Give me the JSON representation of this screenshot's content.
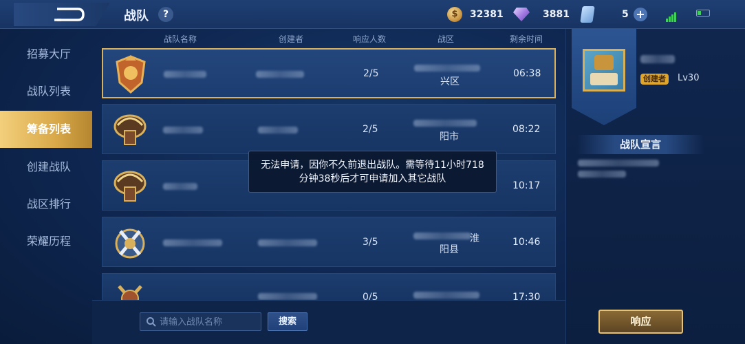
{
  "header": {
    "title": "战队",
    "help_label": "?",
    "currencies": {
      "coins": "32381",
      "gems": "3881",
      "tickets": "5"
    },
    "plus_label": "+"
  },
  "sidebar": {
    "items": [
      {
        "label": "招募大厅"
      },
      {
        "label": "战队列表"
      },
      {
        "label": "筹备列表"
      },
      {
        "label": "创建战队"
      },
      {
        "label": "战区排行"
      },
      {
        "label": "荣耀历程"
      }
    ],
    "active_index": 2
  },
  "table": {
    "columns": [
      "战队名称",
      "创建者",
      "响应人数",
      "战区",
      "剩余时间"
    ],
    "rows": [
      {
        "responses": "2/5",
        "region": "兴区",
        "time": "06:38"
      },
      {
        "responses": "2/5",
        "region": "阳市",
        "time": "08:22"
      },
      {
        "responses": "",
        "region": "",
        "time": "10:17"
      },
      {
        "responses": "3/5",
        "region_line1": "淮",
        "region_line2": "阳县",
        "time": "10:46"
      },
      {
        "responses": "0/5",
        "region": "",
        "time": "17:30"
      }
    ]
  },
  "toast": {
    "line1": "无法申请，因你不久前退出战队。需等待11小时718",
    "line2": "分钟38秒后才可申请加入其它战队"
  },
  "search": {
    "placeholder": "请输入战队名称",
    "button_label": "搜索"
  },
  "profile": {
    "creator_tag": "创建者",
    "level": "Lv30",
    "declaration_title": "战队宣言",
    "respond_label": "响应"
  },
  "colors": {
    "accent_gold": "#d9b15d",
    "active_tab": "#f3cf7c",
    "panel_bg": "#173564"
  }
}
